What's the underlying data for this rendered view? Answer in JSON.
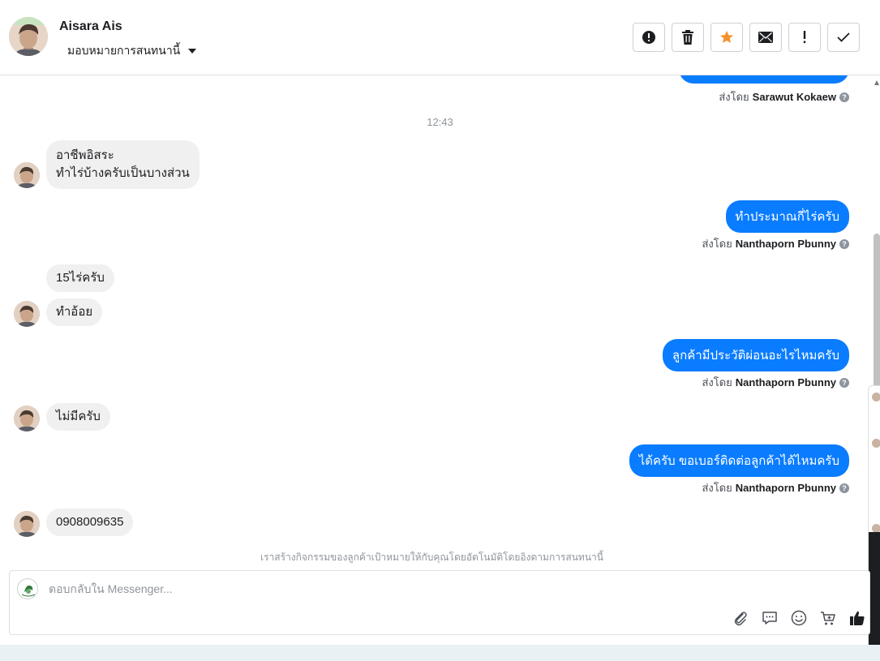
{
  "header": {
    "contact_name": "Aisara Ais",
    "assign_label": "มอบหมายการสนทนานี้",
    "actions": [
      {
        "icon": "alert-circle-icon",
        "name": "spam-button"
      },
      {
        "icon": "trash-icon",
        "name": "delete-button"
      },
      {
        "icon": "star-icon",
        "name": "star-button"
      },
      {
        "icon": "envelope-icon",
        "name": "mark-unread-button"
      },
      {
        "icon": "exclamation-icon",
        "name": "follow-up-button"
      },
      {
        "icon": "check-icon",
        "name": "done-button"
      }
    ],
    "star_color": "#f5902b"
  },
  "thread": {
    "sent_by_prefix": "ส่งโดย",
    "messages": [
      {
        "sender_name": "Sarawut Kokaew"
      },
      {
        "time": "12:43"
      },
      {
        "lines": [
          "อาชีพอิสระ",
          "ทำไร่บ้างครับเป็นบางส่วน"
        ]
      },
      {
        "text": "ทำประมาณกี่ไร่ครับ",
        "sender_name": "Nanthaporn Pbunny"
      },
      {
        "text": "15ไร่ครับ"
      },
      {
        "text": "ทำอ้อย"
      },
      {
        "text": "ลูกค้ามีประวัติผ่อนอะไรไหมครับ",
        "sender_name": "Nanthaporn Pbunny"
      },
      {
        "text": "ไม่มีครับ"
      },
      {
        "text": "ได้ครับ ขอเบอร์ติดต่อลูกค้าได้ไหมครับ",
        "sender_name": "Nanthaporn Pbunny"
      },
      {
        "text": "0908009635"
      }
    ],
    "notice": "เราสร้างกิจกรรมของลูกค้าเป้าหมายให้กับคุณโดยอัตโนมัติโดยอิงตามการสนทนานี้"
  },
  "composer": {
    "placeholder": "ตอบกลับใน Messenger...",
    "tools": [
      "paperclip-icon",
      "saved-reply-icon",
      "emoji-icon",
      "cart-icon",
      "thumbs-up-icon"
    ]
  },
  "colors": {
    "outgoing_bubble": "#0a7cff",
    "incoming_bubble": "#f0f0f0"
  }
}
